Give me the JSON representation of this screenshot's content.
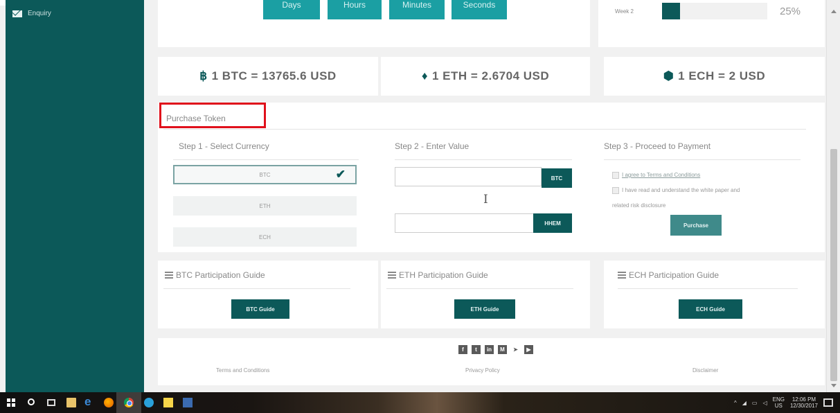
{
  "sidebar": {
    "items": [
      {
        "label": "Enquiry",
        "icon": "envelope-icon"
      }
    ]
  },
  "countdown": {
    "buttons": [
      "Days",
      "Hours",
      "Minutes",
      "Seconds"
    ]
  },
  "progress": {
    "week_label": "Week 2",
    "percent_text": "25%",
    "percent_value": 0.17
  },
  "rates": {
    "btc": {
      "icon": "฿",
      "text": "1 BTC = 13765.6 USD"
    },
    "eth": {
      "icon": "♦",
      "text": "1 ETH = 2.6704 USD"
    },
    "ech": {
      "icon": "⬢",
      "text": "1 ECH = 2 USD"
    }
  },
  "purchase": {
    "title": "Purchase Token",
    "step1": {
      "title": "Step 1 - Select Currency",
      "options": [
        "BTC",
        "ETH",
        "ECH"
      ],
      "selected": "BTC",
      "check": "✔"
    },
    "step2": {
      "title": "Step 2 - Enter Value",
      "btc_value": "",
      "btc_tag": "BTC",
      "hhem_value": "",
      "hhem_tag": "HHEM",
      "cursor": "I"
    },
    "step3": {
      "title": "Step 3 - Proceed to Payment",
      "agree_terms": "I agree to Terms and Conditions",
      "agree_paper_line1": "I have read and understand the white paper and",
      "agree_paper_line2": "related risk disclosure",
      "button": "Purchase"
    }
  },
  "guides": {
    "btc": {
      "title": "BTC Participation Guide",
      "button": "BTC Guide"
    },
    "eth": {
      "title": "ETH Participation Guide",
      "button": "ETH Guide"
    },
    "ech": {
      "title": "ECH Participation Guide",
      "button": "ECH Guide"
    }
  },
  "footer": {
    "social": [
      {
        "icon": "facebook-icon",
        "glyph": "f"
      },
      {
        "icon": "twitter-icon",
        "glyph": "t"
      },
      {
        "icon": "linkedin-icon",
        "glyph": "in"
      },
      {
        "icon": "medium-icon",
        "glyph": "M"
      },
      {
        "icon": "telegram-icon",
        "glyph": "➤"
      },
      {
        "icon": "youtube-icon",
        "glyph": "▶"
      }
    ],
    "links": [
      "Terms and Conditions",
      "Privacy Policy",
      "Disclaimer"
    ]
  },
  "taskbar": {
    "tray": {
      "lang_top": "ENG",
      "lang_bottom": "US",
      "time": "12:06 PM",
      "date": "12/30/2017"
    }
  },
  "colors": {
    "primary": "#0c5959",
    "accent": "#1b9fa3",
    "highlight": "#e0101b"
  }
}
